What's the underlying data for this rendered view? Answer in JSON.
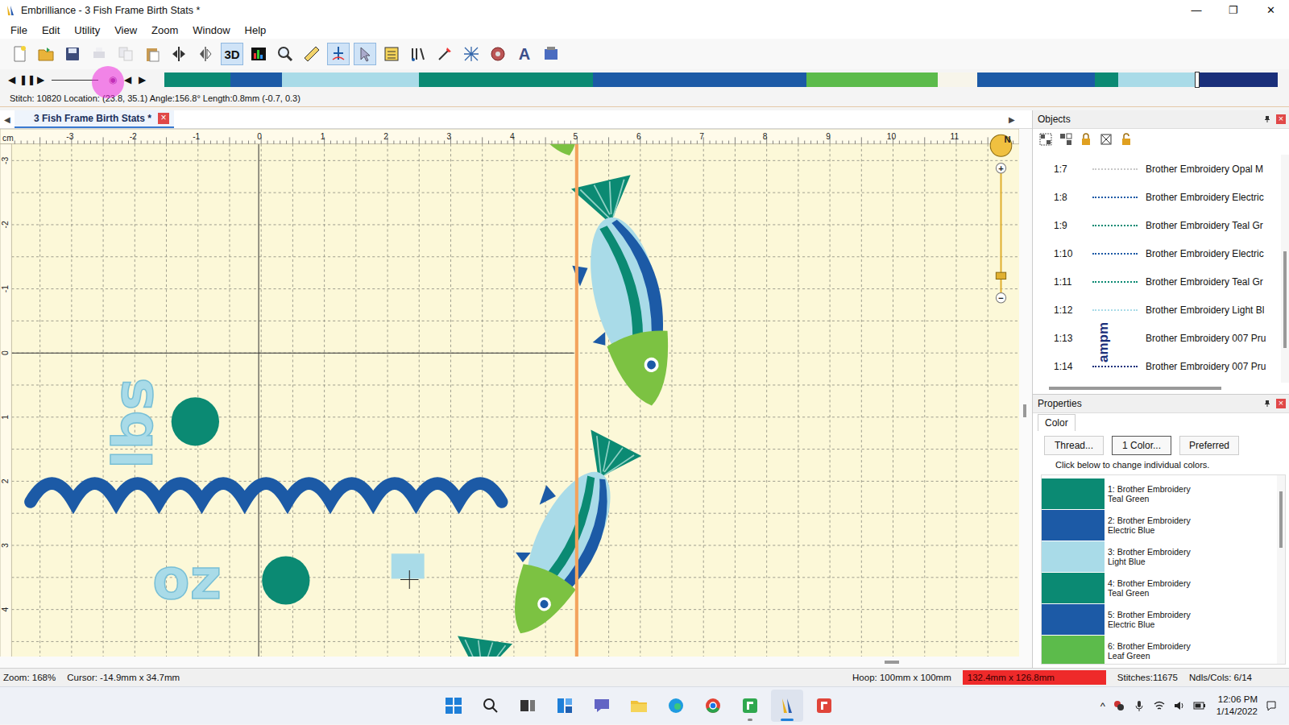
{
  "window": {
    "title": "Embrilliance -  3 Fish Frame Birth Stats *",
    "controls": [
      "—",
      "❐",
      "✕"
    ]
  },
  "menu": [
    {
      "label": "File"
    },
    {
      "label": "Edit"
    },
    {
      "label": "Utility"
    },
    {
      "label": "View"
    },
    {
      "label": "Zoom"
    },
    {
      "label": "Window"
    },
    {
      "label": "Help"
    }
  ],
  "toolbar": [
    {
      "kind": "icon",
      "selected": false,
      "disabled": false
    },
    {
      "kind": "icon",
      "selected": false,
      "disabled": false
    },
    {
      "kind": "icon",
      "selected": false,
      "disabled": false
    },
    {
      "kind": "icon",
      "selected": false,
      "disabled": true
    },
    {
      "kind": "icon",
      "selected": false,
      "disabled": true
    },
    {
      "kind": "icon",
      "selected": false,
      "disabled": false
    },
    {
      "kind": "icon",
      "selected": false,
      "disabled": false
    },
    {
      "kind": "icon",
      "selected": false,
      "disabled": false
    },
    {
      "kind": "text",
      "label": "3D",
      "selected": true,
      "disabled": false
    },
    {
      "kind": "icon",
      "selected": false,
      "disabled": false
    },
    {
      "kind": "icon",
      "selected": false,
      "disabled": false
    },
    {
      "kind": "icon",
      "selected": false,
      "disabled": false
    },
    {
      "kind": "icon",
      "selected": true,
      "disabled": false
    },
    {
      "kind": "icon",
      "selected": true,
      "disabled": false
    },
    {
      "kind": "icon",
      "selected": false,
      "disabled": false
    },
    {
      "kind": "icon",
      "selected": false,
      "disabled": false
    },
    {
      "kind": "icon",
      "selected": false,
      "disabled": false
    },
    {
      "kind": "icon",
      "selected": false,
      "disabled": false
    },
    {
      "kind": "icon",
      "selected": false,
      "disabled": false
    },
    {
      "kind": "text",
      "label": "A",
      "selected": false,
      "disabled": false
    },
    {
      "kind": "icon",
      "selected": false,
      "disabled": false
    }
  ],
  "player": {
    "buttons_left": [
      "◀",
      "❚❚",
      "▶"
    ],
    "buttons_right": [
      "◉",
      "◀",
      "▶"
    ],
    "click_highlight": true
  },
  "colorbar": {
    "level": 0.928,
    "segments": [
      {
        "color": "#0b8a73",
        "level": 0.059
      },
      {
        "color": "#1c5aa6",
        "level": 0.047
      },
      {
        "color": "#a9dbe8",
        "level": 0.123
      },
      {
        "color": "#0b8a73",
        "level": 0.156
      },
      {
        "color": "#1c5aa6",
        "level": 0.192
      },
      {
        "color": "#5cbb4b",
        "level": 0.118
      },
      {
        "color": "#f7f5ea",
        "level": 0.035
      },
      {
        "color": "#1c5aa6",
        "level": 0.106
      },
      {
        "color": "#0b8a73",
        "level": 0.021
      },
      {
        "color": "#a9dbe8",
        "level": 0.069
      },
      {
        "color": "#1a2f7a",
        "level": 0.074
      }
    ]
  },
  "status_line": "Stitch: 10820 Location: (23.8, 35.1) Angle:156.8° Length:0.8mm (-0.7, 0.3)",
  "document_tabs": {
    "scroll_left": "◀",
    "scroll_right": "▶",
    "tabs": [
      {
        "label": "3 Fish Frame Birth Stats *",
        "close": "×",
        "selected": true
      }
    ]
  },
  "canvas": {
    "unit": "cm",
    "ruler_top": [
      "-3",
      "-2",
      "-1",
      "0",
      "1",
      "2",
      "3",
      "4",
      "5",
      "6",
      "7",
      "8",
      "9",
      "10",
      "11"
    ],
    "ruler_left": [
      "-3",
      "-2",
      "-1",
      "0",
      "1",
      "2",
      "3",
      "4"
    ],
    "texts": [
      {
        "text": "lbs"
      },
      {
        "text": "oz"
      }
    ],
    "zoom": {
      "compass": "N",
      "plus": "+",
      "minus": "−",
      "level": 0.17
    }
  },
  "objects": {
    "title": "Objects",
    "close": "×",
    "rows": [
      {
        "label": "1:7",
        "thread": "Brother Embroidery Opal M",
        "thumb": "",
        "color": "#c8c8c8",
        "selected": false
      },
      {
        "label": "1:8",
        "thread": "Brother Embroidery Electric",
        "thumb": "",
        "color": "#1c5aa6",
        "selected": false
      },
      {
        "label": "1:9",
        "thread": "Brother Embroidery Teal Gr",
        "thumb": "",
        "color": "#0b8a73",
        "selected": false
      },
      {
        "label": "1:10",
        "thread": "Brother Embroidery Electric",
        "thumb": "",
        "color": "#1c5aa6",
        "selected": false
      },
      {
        "label": "1:11",
        "thread": "Brother Embroidery Teal Gr",
        "thumb": "",
        "color": "#0b8a73",
        "selected": false
      },
      {
        "label": "1:12",
        "thread": "Brother Embroidery Light Bl",
        "thumb": "",
        "color": "#a9dbe8",
        "selected": false
      },
      {
        "label": "1:13",
        "thread": "Brother Embroidery 007 Pru",
        "thumb": "ampm",
        "color": "#1a2f7a",
        "selected": false
      },
      {
        "label": "1:14",
        "thread": "Brother Embroidery 007 Pru",
        "thumb": "",
        "color": "#1a2f7a",
        "selected": false
      }
    ]
  },
  "properties": {
    "title": "Properties",
    "close": "×",
    "tabs": [
      {
        "label": "Color",
        "selected": true
      }
    ],
    "buttons": [
      {
        "label": "Thread...",
        "selected": false
      },
      {
        "label": "1 Color...",
        "selected": true
      },
      {
        "label": "Preferred",
        "selected": false
      }
    ],
    "hint": "Click below to change individual colors.",
    "colors": [
      {
        "label": "1: Brother Embroidery Teal Green",
        "color": "#0b8a73"
      },
      {
        "label": "2: Brother Embroidery Electric Blue",
        "color": "#1c5aa6"
      },
      {
        "label": "3: Brother Embroidery Light Blue",
        "color": "#a9dbe8"
      },
      {
        "label": "4: Brother Embroidery Teal Green",
        "color": "#0b8a73"
      },
      {
        "label": "5: Brother Embroidery Electric Blue",
        "color": "#1c5aa6"
      },
      {
        "label": "6: Brother Embroidery Leaf Green",
        "color": "#5cbb4b"
      }
    ]
  },
  "status_bar": {
    "zoom": "Zoom: 168%",
    "cursor": "Cursor: -14.9mm x 34.7mm",
    "hoop": "Hoop: 100mm x 100mm",
    "design_size": {
      "text": "132.4mm x 126.8mm",
      "over": true
    },
    "stitches": "Stitches:11675",
    "needles": "Ndls/Cols: 6/14"
  },
  "taskbar": {
    "apps": [
      {
        "running": false,
        "selected": false
      },
      {
        "running": false,
        "selected": false
      },
      {
        "running": false,
        "selected": false
      },
      {
        "running": false,
        "selected": false
      },
      {
        "running": false,
        "selected": false
      },
      {
        "running": false,
        "selected": false
      },
      {
        "running": false,
        "selected": false
      },
      {
        "running": false,
        "selected": false
      },
      {
        "running": true,
        "selected": false
      },
      {
        "running": true,
        "selected": true
      },
      {
        "running": false,
        "selected": false
      }
    ],
    "tray_arrow": "^",
    "time": "12:06 PM",
    "date": "1/14/2022"
  }
}
